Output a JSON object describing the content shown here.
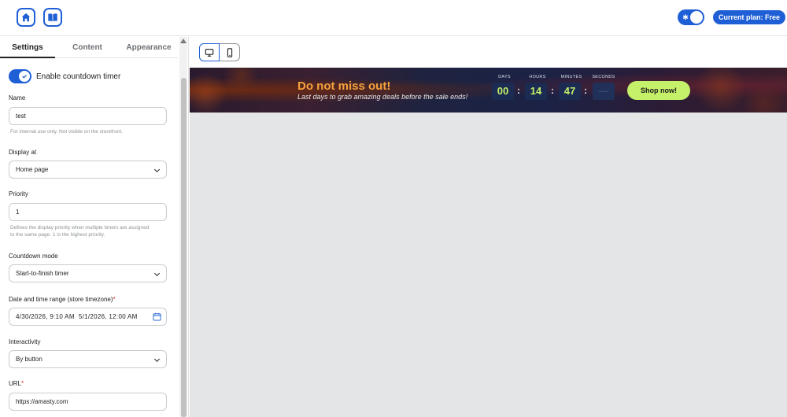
{
  "topbar": {
    "home_icon": "home-icon",
    "docs_icon": "book-icon",
    "theme_icon": "sun-icon",
    "plan_label": "Current plan: Free"
  },
  "sidebar": {
    "tabs": [
      {
        "label": "Settings",
        "active": true
      },
      {
        "label": "Content",
        "active": false
      },
      {
        "label": "Appearance",
        "active": false
      }
    ],
    "enable_label": "Enable countdown timer",
    "name_label": "Name",
    "name_value": "test",
    "name_help": "For internal use only. Not visible on the storefront.",
    "display_label": "Display at",
    "display_value": "Home page",
    "priority_label": "Priority",
    "priority_value": "1",
    "priority_help": "Defines the display priority when multiple timers are assigned to the same page. 1 is the highest priority.",
    "mode_label": "Countdown mode",
    "mode_value": "Start-to-finish timer",
    "range_label": "Date and time range (store timezone)",
    "range_required": "*",
    "range_value": "4/30/2026, 9:10 AM  5/1/2026, 12:00 AM",
    "interactivity_label": "Interactivity",
    "interactivity_value": "By button",
    "url_label": "URL",
    "url_required": "*",
    "url_value": "https://amasty.com"
  },
  "preview": {
    "desktop_icon": "monitor-icon",
    "mobile_icon": "smartphone-icon",
    "banner": {
      "title": "Do not miss out!",
      "subtitle": "Last days to grab amazing deals before the sale ends!",
      "units": [
        "DAYS",
        "HOURS",
        "MINUTES",
        "SECONDS"
      ],
      "values": [
        "00",
        "14",
        "47",
        "—"
      ],
      "separator": ":",
      "button_label": "Shop now!",
      "accent_color": "#c5f06a",
      "title_color": "#f5a33c"
    }
  },
  "colors": {
    "brand": "#1f5fd6",
    "canvas": "#e4e5e7"
  }
}
